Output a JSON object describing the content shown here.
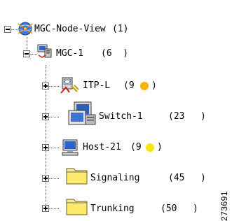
{
  "tree": {
    "root": {
      "label": "MGC-Node-View",
      "count": "(1)",
      "icon": "network-globe-icon"
    },
    "mgc": {
      "label": "MGC-1",
      "count": "(6  )",
      "icon": "server-node-icon"
    },
    "children": [
      {
        "label": "ITP-L",
        "count_open": "(9",
        "count_close": ")",
        "icon": "signaling-gateway-icon",
        "status_color": "#f7b500"
      },
      {
        "label": "Switch-1",
        "count_open": "(23",
        "count_close": ")",
        "icon": "switch-computer-icon"
      },
      {
        "label": "Host-21",
        "count_open": "(9",
        "count_close": ")",
        "icon": "host-computer-icon",
        "status_color": "#f8e600"
      },
      {
        "label": "Signaling",
        "count_open": "(45",
        "count_close": ")",
        "icon": "folder-icon"
      },
      {
        "label": "Trunking",
        "count_open": "(50",
        "count_close": ")",
        "icon": "folder-icon"
      }
    ]
  },
  "figure_id": "273691"
}
